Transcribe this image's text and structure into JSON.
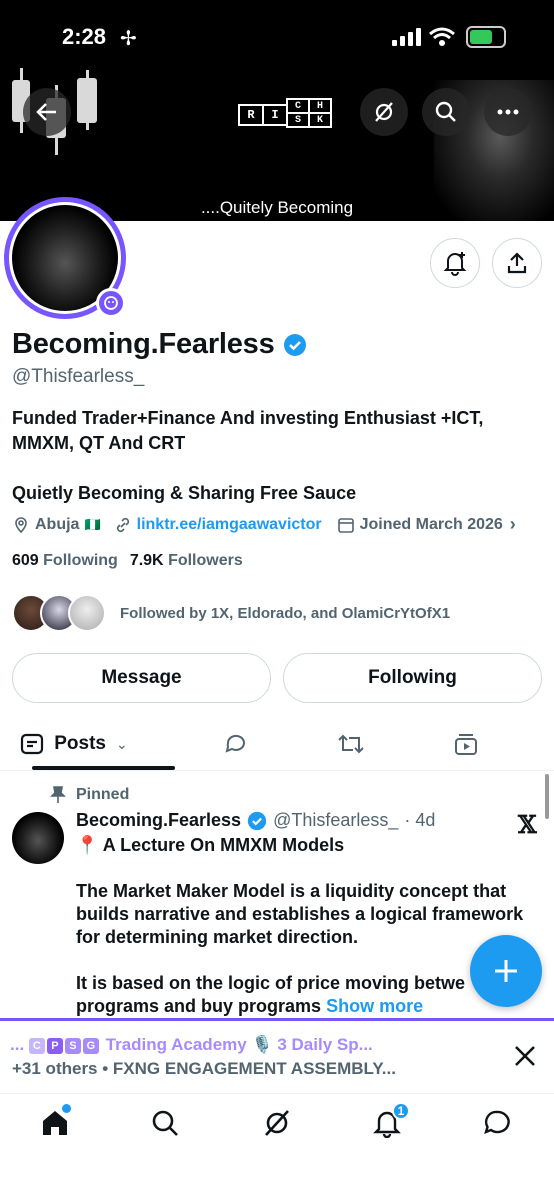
{
  "status_bar": {
    "time": "2:28"
  },
  "banner": {
    "logo_letters": [
      "R",
      "I",
      "C",
      "H",
      "S",
      "K"
    ],
    "caption": "....Quitely Becoming"
  },
  "profile": {
    "name": "Becoming.Fearless",
    "handle": "@Thisfearless_",
    "bio_line1": "Funded Trader+Finance And investing Enthusiast +ICT,",
    "bio_line2": "MMXM, QT And CRT",
    "bio_line3": "Quietly Becoming & Sharing Free Sauce",
    "location": "Abuja",
    "flag": "🇳🇬",
    "link": "linktr.ee/iamgaawavictor",
    "joined": "Joined March 2026",
    "following_count": "609",
    "following_label": "Following",
    "followers_count": "7.9K",
    "followers_label": "Followers",
    "followed_by": "Followed by 1X, Eldorado, and OlamiCrYtOfX1"
  },
  "actions": {
    "message": "Message",
    "following": "Following"
  },
  "tabs": {
    "posts": "Posts"
  },
  "pinned_post": {
    "pinned_label": "Pinned",
    "author": "Becoming.Fearless",
    "handle": "@Thisfearless_",
    "time": "· 4d",
    "title_emoji": "📍",
    "title": "A Lecture On MMXM Models",
    "para1_l1": "The Market Maker Model is a liquidity concept that",
    "para1_l2": "builds narrative and establishes a logical framework",
    "para1_l3": "for determining market direction.",
    "para2_l1": "It is based on the logic of price moving betwe",
    "para2_l2": "programs and buy programs",
    "show_more": "Show more"
  },
  "space_bar": {
    "line1_prefix": "...",
    "line1_badges": [
      "C",
      "P",
      "S",
      "G"
    ],
    "line1_text": "Trading Academy 🎙️ 3 Daily Sp...",
    "line2": "+31 others • FXNG ENGAGEMENT ASSEMBLY..."
  },
  "bottom_nav": {
    "notifications_badge": "1"
  },
  "colors": {
    "accent": "#1d9bf0",
    "purple": "#7856ff",
    "text": "#0f1419",
    "muted": "#536471"
  }
}
